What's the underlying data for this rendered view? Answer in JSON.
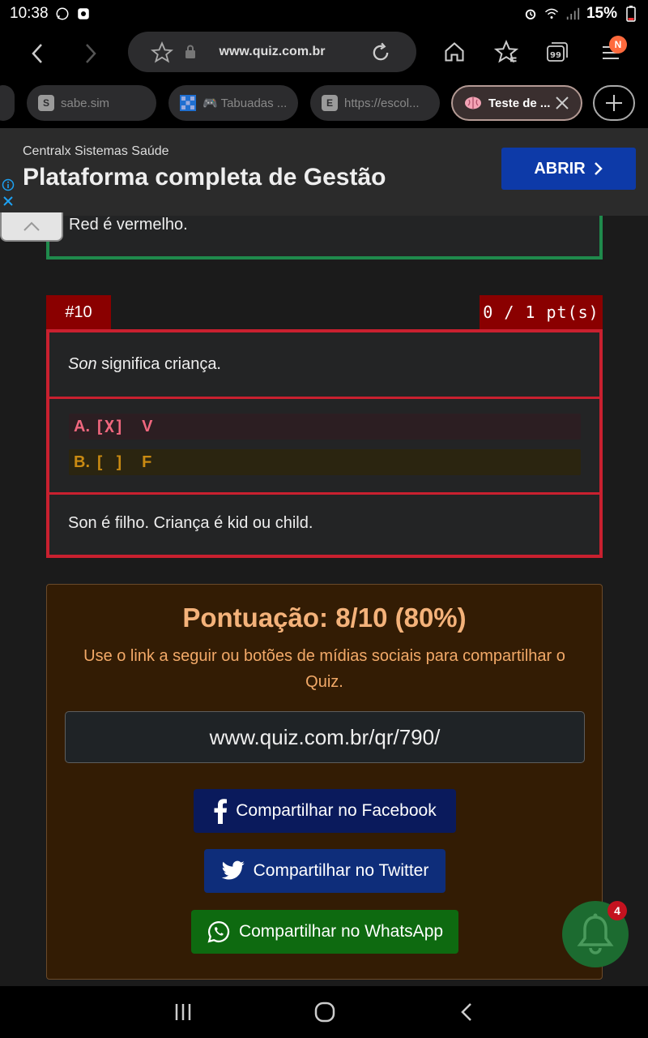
{
  "status_bar": {
    "time": "10:38",
    "battery": "15%"
  },
  "browser": {
    "url": "www.quiz.com.br",
    "menu_badge": "N",
    "tabs": [
      {
        "label": "sabe.sim",
        "favicon": "S"
      },
      {
        "label": "🎮 Tabuadas ...",
        "favicon": ""
      },
      {
        "label": "https://escol...",
        "favicon": "E"
      },
      {
        "label": "Teste de ...",
        "favicon": ""
      }
    ]
  },
  "ad": {
    "company": "Centralx Sistemas Saúde",
    "headline": "Plataforma completa de Gestão",
    "cta": "ABRIR"
  },
  "previous_answer": {
    "explanation": "Red é vermelho."
  },
  "question": {
    "number": "#10",
    "points": "0 / 1 pt(s)",
    "word": "Son",
    "text": " significa criança.",
    "options": [
      {
        "letter": "A.",
        "mark": "[X]",
        "value": "V"
      },
      {
        "letter": "B.",
        "mark": "[ ]",
        "value": "F"
      }
    ],
    "explanation": "Son é filho. Criança é kid ou child."
  },
  "score": {
    "title": "Pontuação: 8/10 (80%)",
    "description": "Use o link a seguir ou botões de mídias sociais para compartilhar o Quiz.",
    "link": "www.quiz.com.br/qr/790/",
    "share_facebook": "Compartilhar no Facebook",
    "share_twitter": "Compartilhar no Twitter",
    "share_whatsapp": "Compartilhar no WhatsApp"
  },
  "notifications": {
    "count": "4"
  },
  "colors": {
    "correct_border": "#1f8a4c",
    "wrong_border": "#c9202f",
    "score_bg": "#331c04",
    "score_text": "#f4b27a"
  }
}
